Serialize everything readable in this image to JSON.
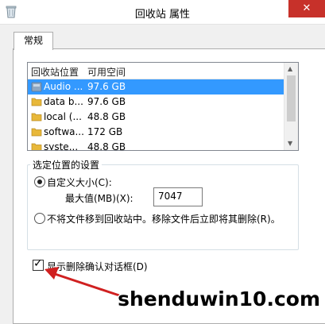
{
  "window": {
    "title": "回收站 属性",
    "close_glyph": "✕"
  },
  "tabs": [
    {
      "label": "常规",
      "active": true
    }
  ],
  "recycle_list": {
    "columns": [
      "回收站位置",
      "可用空间"
    ],
    "rows": [
      {
        "location": "Audio ...",
        "space": "97.6 GB",
        "selected": true
      },
      {
        "location": "data b...",
        "space": "97.6 GB",
        "selected": false
      },
      {
        "location": "local (...",
        "space": "48.8 GB",
        "selected": false
      },
      {
        "location": "softwa...",
        "space": "172 GB",
        "selected": false
      },
      {
        "location": "syste...",
        "space": "48.8 GB",
        "selected": false
      }
    ]
  },
  "settings": {
    "legend": "选定位置的设置",
    "custom_size_label": "自定义大小(C):",
    "max_value_label": "最大值(MB)(X):",
    "max_value": "7047",
    "no_recycle_label": "不将文件移到回收站中。移除文件后立即将其删除(R)。",
    "custom_size_selected": true
  },
  "confirm_dialog": {
    "label": "显示删除确认对话框(D)",
    "checked": true
  },
  "annotation": {
    "number": "1",
    "color": "#d02020"
  },
  "watermark": "shenduwin10.com",
  "colors": {
    "selection": "#3399ff",
    "close_button": "#c7312a",
    "folder": "#e8b83a"
  }
}
